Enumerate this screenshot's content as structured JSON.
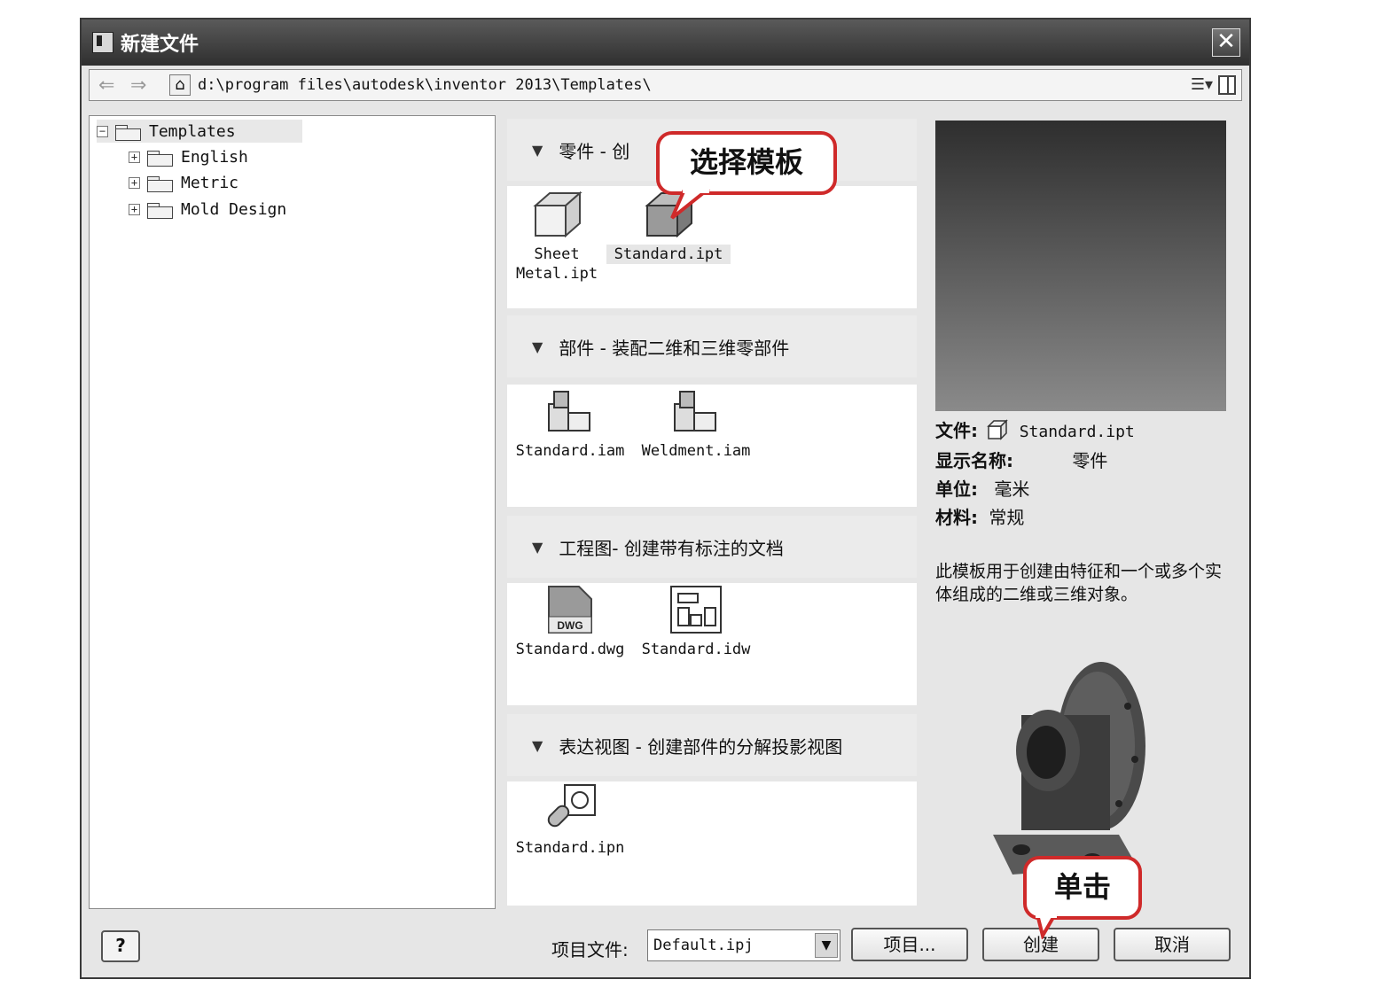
{
  "dialog": {
    "title": "新建文件",
    "close_label": "✕",
    "path": "d:\\program files\\autodesk\\inventor 2013\\Templates\\"
  },
  "tree": {
    "root": "Templates",
    "children": [
      "English",
      "Metric",
      "Mold Design"
    ]
  },
  "sections": [
    {
      "header": "零件 - 创",
      "templates": [
        "Sheet\nMetal.ipt",
        "Standard.ipt"
      ]
    },
    {
      "header": "部件 - 装配二维和三维零部件",
      "templates": [
        "Standard.iam",
        "Weldment.iam"
      ]
    },
    {
      "header": "工程图- 创建带有标注的文档",
      "templates": [
        "Standard.dwg",
        "Standard.idw"
      ],
      "dwg_badge": "DWG"
    },
    {
      "header": "表达视图 - 创建部件的分解投影视图",
      "templates": [
        "Standard.ipn"
      ]
    }
  ],
  "info": {
    "file_label": "文件:",
    "file_value": "Standard.ipt",
    "display_label": "显示名称:",
    "display_value": "零件",
    "unit_label": "单位:",
    "unit_value": "毫米",
    "material_label": "材料:",
    "material_value": "常规",
    "description": "此模板用于创建由特征和一个或多个实体组成的二维或三维对象。"
  },
  "footer": {
    "help_label": "?",
    "project_label": "项目文件:",
    "project_value": "Default.ipj",
    "projects_button": "项目...",
    "create_button": "创建",
    "cancel_button": "取消"
  },
  "annotations": {
    "select_template": "选择模板",
    "click": "单击",
    "accent_color": "#cf2a2a"
  }
}
